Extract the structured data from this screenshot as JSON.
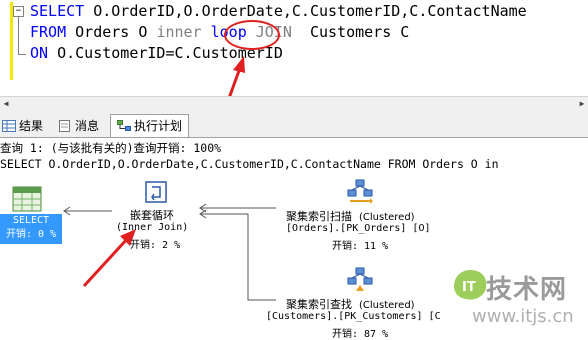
{
  "editor": {
    "line1": {
      "kw": "SELECT",
      "rest": " O.OrderID,O.OrderDate,C.CustomerID,C.ContactName"
    },
    "line2": {
      "kw1": "FROM",
      "t1": " Orders O ",
      "g1": "inner",
      "sp": " ",
      "loop": "loop",
      "g2": " JOIN",
      "t2": "  Customers C"
    },
    "line3": {
      "kw": "ON",
      "rest": " O.CustomerID=C.CustomerID"
    },
    "fold_symbol": "−"
  },
  "tabs": [
    {
      "label": "结果",
      "icon": "grid-icon"
    },
    {
      "label": "消息",
      "icon": "message-icon"
    },
    {
      "label": "执行计划",
      "icon": "plan-icon"
    }
  ],
  "plan": {
    "header1": "查询 1: (与该批有关的)查询开销: 100%",
    "header2": "SELECT O.OrderID,O.OrderDate,C.CustomerID,C.ContactName FROM Orders O in",
    "select_node": {
      "label": "SELECT",
      "cost": "开销: 0 %"
    },
    "nested_loops": {
      "label": "嵌套循环",
      "sub": "(Inner Join)",
      "cost": "开销: 2 %"
    },
    "clustered_scan": {
      "label": "聚集索引扫描",
      "tag": "(Clustered)",
      "object": "[Orders].[PK_Orders] [O]",
      "cost": "开销: 11 %"
    },
    "clustered_seek": {
      "label": "聚集索引查找",
      "tag": "(Clustered)",
      "object": "[Customers].[PK_Customers] [C",
      "cost": "开销: 87 %"
    }
  },
  "watermark": {
    "brand": "技术网",
    "url": "www.itjs.cn",
    "badge": "IT"
  },
  "colors": {
    "keyword": "#0000ff",
    "annotation": "#e02020",
    "select_bg": "#3399ff",
    "accent": "#f4e800"
  }
}
